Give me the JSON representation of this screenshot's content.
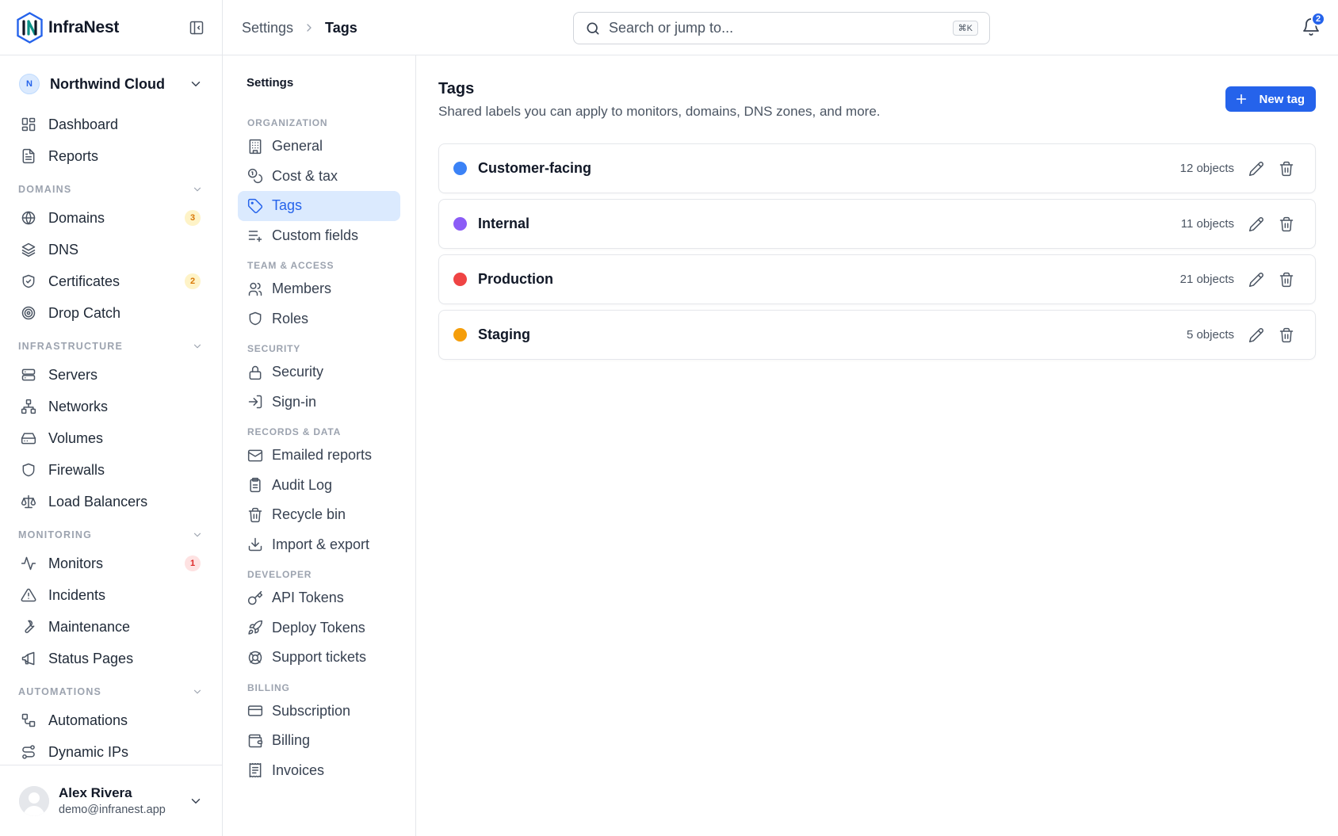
{
  "app": {
    "name": "InfraNest"
  },
  "org": {
    "initial": "N",
    "name": "Northwind Cloud"
  },
  "sidebar": {
    "top_items": [
      {
        "label": "Dashboard",
        "icon": "dashboard-icon"
      },
      {
        "label": "Reports",
        "icon": "reports-icon"
      }
    ],
    "sections": [
      {
        "title": "DOMAINS",
        "items": [
          {
            "label": "Domains",
            "icon": "globe-icon",
            "badge": "3",
            "badge_color": "amber"
          },
          {
            "label": "DNS",
            "icon": "layers-icon"
          },
          {
            "label": "Certificates",
            "icon": "shield-check-icon",
            "badge": "2",
            "badge_color": "amber"
          },
          {
            "label": "Drop Catch",
            "icon": "target-icon"
          }
        ]
      },
      {
        "title": "INFRASTRUCTURE",
        "items": [
          {
            "label": "Servers",
            "icon": "server-icon"
          },
          {
            "label": "Networks",
            "icon": "network-icon"
          },
          {
            "label": "Volumes",
            "icon": "hard-drive-icon"
          },
          {
            "label": "Firewalls",
            "icon": "shield-icon"
          },
          {
            "label": "Load Balancers",
            "icon": "scale-icon"
          }
        ]
      },
      {
        "title": "MONITORING",
        "items": [
          {
            "label": "Monitors",
            "icon": "activity-icon",
            "badge": "1",
            "badge_color": "red"
          },
          {
            "label": "Incidents",
            "icon": "alert-triangle-icon"
          },
          {
            "label": "Maintenance",
            "icon": "wrench-icon"
          },
          {
            "label": "Status Pages",
            "icon": "megaphone-icon"
          }
        ]
      },
      {
        "title": "AUTOMATIONS",
        "items": [
          {
            "label": "Automations",
            "icon": "workflow-icon"
          },
          {
            "label": "Dynamic IPs",
            "icon": "route-icon"
          }
        ]
      }
    ]
  },
  "user": {
    "name": "Alex Rivera",
    "email": "demo@infranest.app"
  },
  "topbar": {
    "breadcrumb": [
      "Settings",
      "Tags"
    ],
    "search_placeholder": "Search or jump to...",
    "search_shortcut": "⌘K",
    "notifications_count": "2"
  },
  "settings_nav": {
    "title": "Settings",
    "sections": [
      {
        "title": "ORGANIZATION",
        "items": [
          {
            "label": "General",
            "icon": "building-icon"
          },
          {
            "label": "Cost & tax",
            "icon": "coins-icon"
          },
          {
            "label": "Tags",
            "icon": "tag-icon",
            "active": true
          },
          {
            "label": "Custom fields",
            "icon": "list-plus-icon"
          }
        ]
      },
      {
        "title": "TEAM & ACCESS",
        "items": [
          {
            "label": "Members",
            "icon": "users-icon"
          },
          {
            "label": "Roles",
            "icon": "shield-icon"
          }
        ]
      },
      {
        "title": "SECURITY",
        "items": [
          {
            "label": "Security",
            "icon": "lock-icon"
          },
          {
            "label": "Sign-in",
            "icon": "log-in-icon"
          }
        ]
      },
      {
        "title": "RECORDS & DATA",
        "items": [
          {
            "label": "Emailed reports",
            "icon": "mail-icon"
          },
          {
            "label": "Audit Log",
            "icon": "clipboard-icon"
          },
          {
            "label": "Recycle bin",
            "icon": "trash-icon"
          },
          {
            "label": "Import & export",
            "icon": "download-icon"
          }
        ]
      },
      {
        "title": "DEVELOPER",
        "items": [
          {
            "label": "API Tokens",
            "icon": "key-icon"
          },
          {
            "label": "Deploy Tokens",
            "icon": "rocket-icon"
          },
          {
            "label": "Support tickets",
            "icon": "life-buoy-icon"
          }
        ]
      },
      {
        "title": "BILLING",
        "items": [
          {
            "label": "Subscription",
            "icon": "credit-card-icon"
          },
          {
            "label": "Billing",
            "icon": "wallet-icon"
          },
          {
            "label": "Invoices",
            "icon": "receipt-icon"
          }
        ]
      }
    ]
  },
  "main": {
    "title": "Tags",
    "subtitle": "Shared labels you can apply to monitors, domains, DNS zones, and more.",
    "new_button": "New tag",
    "tags": [
      {
        "name": "Customer-facing",
        "color": "#3b82f6",
        "count": "12 objects"
      },
      {
        "name": "Internal",
        "color": "#8b5cf6",
        "count": "11 objects"
      },
      {
        "name": "Production",
        "color": "#ef4444",
        "count": "21 objects"
      },
      {
        "name": "Staging",
        "color": "#f59e0b",
        "count": "5 objects"
      }
    ]
  }
}
